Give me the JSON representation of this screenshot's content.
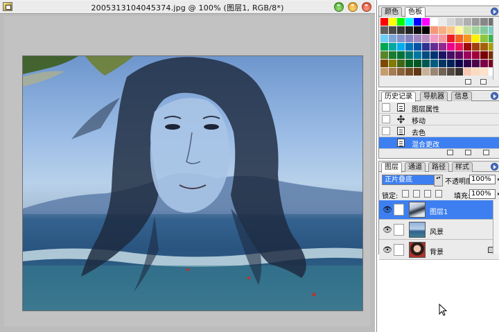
{
  "document": {
    "title": "2005313104045374.jpg @ 100% (图层1, RGB/8*)"
  },
  "swatches": {
    "tabs": [
      "颜色",
      "色板"
    ],
    "active_tab": 1,
    "colors": [
      "#ff0000",
      "#ffff00",
      "#00ff00",
      "#00ffff",
      "#0000ff",
      "#ff00ff",
      "#ffffff",
      "#ebebeb",
      "#d7d7d7",
      "#c3c3c3",
      "#afafaf",
      "#9b9b9b",
      "#878787",
      "#737373",
      "#5f5f5f",
      "#4b4b4b",
      "#373737",
      "#232323",
      "#0f0f0f",
      "#000000",
      "#f7977a",
      "#f9ad81",
      "#fdc68a",
      "#fff79a",
      "#c4df9b",
      "#a3d39c",
      "#82ca9d",
      "#7bcdc8",
      "#6ecff6",
      "#7ea7d8",
      "#8493ca",
      "#8882be",
      "#a187be",
      "#bc8dbf",
      "#f49ac2",
      "#f6989d",
      "#ed1c24",
      "#f26522",
      "#f7941d",
      "#fff200",
      "#8dc63f",
      "#39b54a",
      "#00a651",
      "#00a99d",
      "#00aeef",
      "#0072bc",
      "#0054a6",
      "#2e3192",
      "#662d91",
      "#92278f",
      "#ec008c",
      "#ed145b",
      "#9e0b0f",
      "#a0410d",
      "#a36209",
      "#aba000",
      "#598527",
      "#1a7b30",
      "#007236",
      "#00746b",
      "#0076a3",
      "#004b80",
      "#003471",
      "#1b1464",
      "#440e62",
      "#630460",
      "#9e005d",
      "#9e0039",
      "#790000",
      "#7b2e00",
      "#7d4900",
      "#827b00",
      "#406618",
      "#005e20",
      "#005826",
      "#005952",
      "#005b7f",
      "#003663",
      "#002157",
      "#0d004c",
      "#32004b",
      "#4b0049",
      "#7b0046",
      "#7a0026",
      "#c69c6d",
      "#a67c52",
      "#8c6239",
      "#754c24",
      "#603813",
      "#c7b299",
      "#998675",
      "#736357",
      "#534741",
      "#37302d",
      "#f7c7b0",
      "#fbdabd",
      "#ffe0c8",
      "#ffffff"
    ]
  },
  "history": {
    "tabs": [
      "历史记录",
      "导航器",
      "信息"
    ],
    "active_tab": 0,
    "items": [
      {
        "label": "图层属性",
        "icon": "document-icon"
      },
      {
        "label": "移动",
        "icon": "move-icon"
      },
      {
        "label": "去色",
        "icon": "document-icon"
      },
      {
        "label": "混合更改",
        "icon": "document-icon",
        "selected": true
      }
    ]
  },
  "layers": {
    "tabs": [
      "图层",
      "通道",
      "路径",
      "样式"
    ],
    "active_tab": 0,
    "blend_mode": "正片叠底",
    "opacity_label": "不透明度:",
    "opacity_value": "100%",
    "lock_label": "锁定:",
    "fill_label": "填充:",
    "fill_value": "100%",
    "items": [
      {
        "name": "图层1",
        "active": true,
        "thumb": "woman-hair"
      },
      {
        "name": "风景",
        "active": false,
        "thumb": "beach"
      },
      {
        "name": "背景",
        "active": false,
        "thumb": "portrait",
        "locked": true
      }
    ]
  }
}
